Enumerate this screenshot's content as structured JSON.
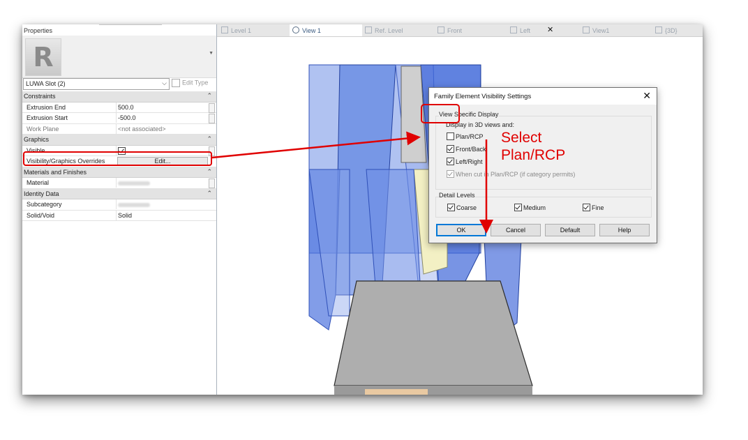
{
  "properties": {
    "title": "Properties",
    "type_selector": "LUWA Slot (2)",
    "edit_type": "Edit Type",
    "rows": [
      {
        "kind": "category",
        "label": "Constraints"
      },
      {
        "kind": "param",
        "name": "Extrusion End",
        "value": "500.0"
      },
      {
        "kind": "param",
        "name": "Extrusion Start",
        "value": "-500.0"
      },
      {
        "kind": "param",
        "name": "Work Plane",
        "value": "<not associated>"
      },
      {
        "kind": "category",
        "label": "Graphics"
      },
      {
        "kind": "param",
        "name": "Visible",
        "value": ""
      },
      {
        "kind": "param",
        "name": "Visibility/Graphics Overrides",
        "value": "Edit..."
      },
      {
        "kind": "category",
        "label": "Materials and Finishes"
      },
      {
        "kind": "param",
        "name": "Material",
        "value": ""
      },
      {
        "kind": "category",
        "label": "Identity Data"
      },
      {
        "kind": "param",
        "name": "Subcategory",
        "value": ""
      },
      {
        "kind": "param",
        "name": "Solid/Void",
        "value": "Solid"
      }
    ],
    "visible_checked": true
  },
  "tabs": [
    {
      "label": "Level 1",
      "active": false
    },
    {
      "label": "View 1",
      "active": true
    },
    {
      "label": "Ref. Level",
      "active": false
    },
    {
      "label": "Front",
      "active": false
    },
    {
      "label": "Left",
      "active": false
    },
    {
      "label": "View1",
      "active": false
    },
    {
      "label": "{3D}",
      "active": false
    }
  ],
  "dialog": {
    "title": "Family Element Visibility Settings",
    "view_specific_label": "View Specific Display",
    "display_in_label": "Display in 3D views and:",
    "options": [
      {
        "label": "Plan/RCP",
        "checked": false
      },
      {
        "label": "Front/Back",
        "checked": true
      },
      {
        "label": "Left/Right",
        "checked": true
      },
      {
        "label": "When cut in Plan/RCP (if category permits)",
        "checked": true,
        "disabled": true
      }
    ],
    "detail_levels_label": "Detail Levels",
    "detail_levels": [
      {
        "label": "Coarse",
        "checked": true
      },
      {
        "label": "Medium",
        "checked": true
      },
      {
        "label": "Fine",
        "checked": true
      }
    ],
    "buttons": {
      "ok": "OK",
      "cancel": "Cancel",
      "default": "Default",
      "help": "Help"
    }
  },
  "annotation": {
    "line1": "Select",
    "line2": "Plan/RCP",
    "color": "#e00000"
  },
  "colors": {
    "accent_red": "#e00000",
    "glass_blue": "#3c66d6",
    "solid_grey": "#a9a9a9"
  }
}
